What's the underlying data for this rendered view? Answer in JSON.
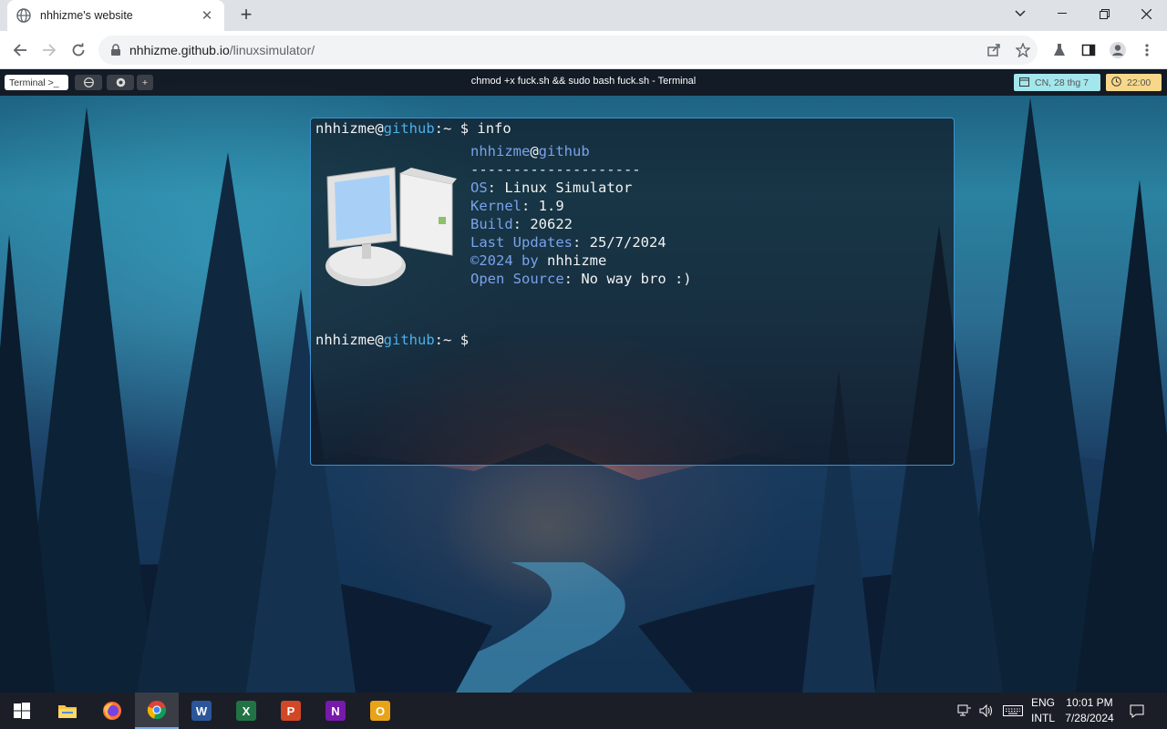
{
  "browser": {
    "tab_title": "nhhizme's website",
    "url_host": "nhhizme.github.io",
    "url_path": "/linuxsimulator/"
  },
  "os_bar": {
    "tabs": [
      "Terminal >_",
      "",
      "",
      "+"
    ],
    "window_title": "chmod +x fuck.sh && sudo bash fuck.sh - Terminal",
    "date": "CN, 28 thg 7",
    "time": "22:00"
  },
  "terminal": {
    "prompt": {
      "user": "nhhizme",
      "at": "@",
      "host": "github",
      "sep": ":~",
      "dollar": "$"
    },
    "command": "info",
    "info": {
      "user": "nhhizme",
      "at": "@",
      "host": "github",
      "divider": "--------------------",
      "os_label": "OS",
      "os_value": "Linux Simulator",
      "kernel_label": "Kernel",
      "kernel_value": "1.9",
      "build_label": "Build",
      "build_value": "20622",
      "updates_label": "Last Updates",
      "updates_value": "25/7/2024",
      "copyright_label": "©2024 by",
      "copyright_value": "nhhizme",
      "source_label": "Open Source",
      "source_value": "No way bro :)"
    }
  },
  "taskbar": {
    "apps": [
      "start-icon",
      "file-explorer-icon",
      "firefox-icon",
      "chrome-icon",
      "word-icon",
      "excel-icon",
      "powerpoint-icon",
      "onenote-icon",
      "outlook-icon"
    ],
    "lang_1": "ENG",
    "lang_2": "INTL",
    "clock_time": "10:01 PM",
    "clock_date": "7/28/2024"
  }
}
